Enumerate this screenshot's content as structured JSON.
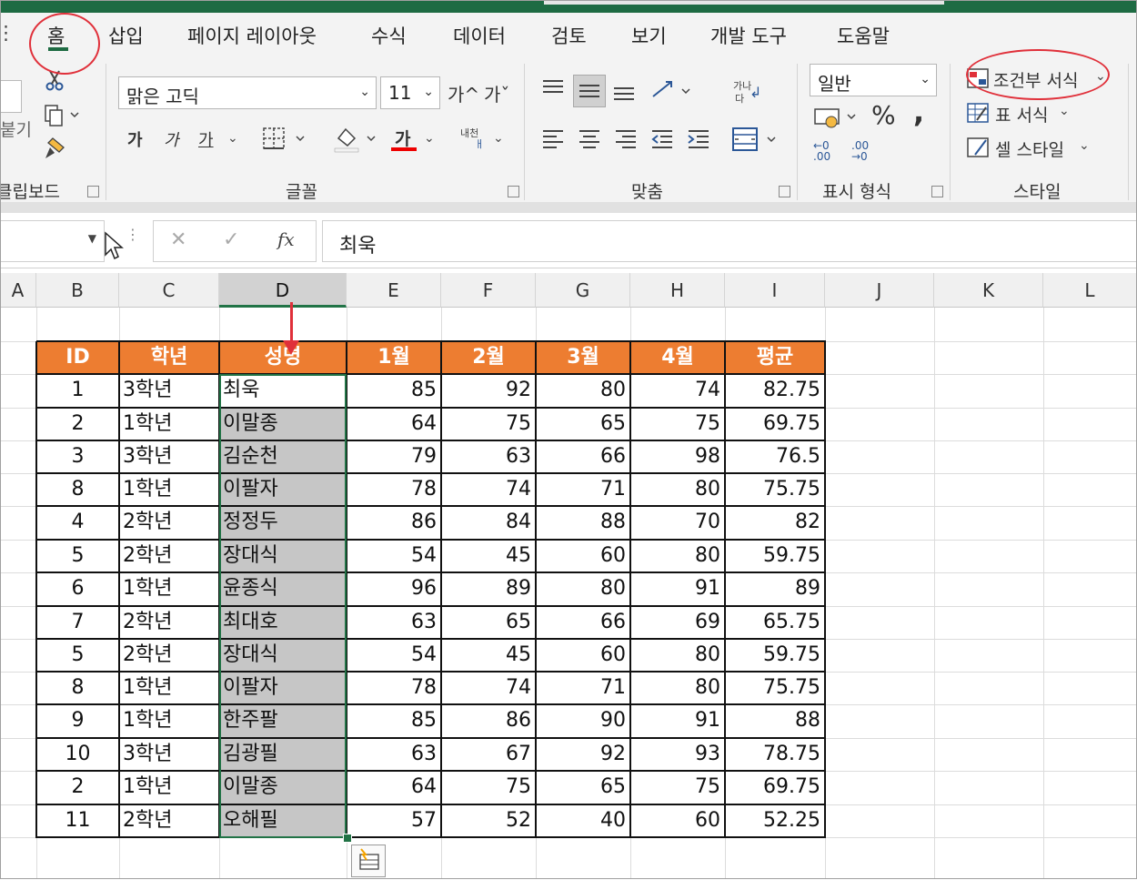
{
  "ribbon_tabs": [
    "홈",
    "삽입",
    "페이지 레이아웃",
    "수식",
    "데이터",
    "검토",
    "보기",
    "개발 도구",
    "도움말"
  ],
  "ribbon": {
    "clipboard_label": "클립보드",
    "clipboard_paste_partial": "붙기",
    "font_group_label": "글꼴",
    "font_name": "맑은 고딕",
    "font_size": "11",
    "increase_font": "가^",
    "decrease_font": "가ˇ",
    "bold": "가",
    "italic": "가",
    "underline": "가",
    "font_color_glyph": "가",
    "phonetic_top": "내천",
    "phonetic_bottom": "ㅐ",
    "align_group_label": "맞춤",
    "wrap_text_top": "가나",
    "wrap_text_bottom": "다",
    "number_group_label": "표시 형식",
    "number_format": "일반",
    "percent": "%",
    "comma": ",",
    "inc_decimal": "←0 .00",
    "dec_decimal": ".00 →0",
    "styles_group_label": "스타일",
    "conditional_formatting": "조건부 서식",
    "format_as_table": "표 서식",
    "cell_styles": "셀 스타일"
  },
  "formula_bar": {
    "name_box": "",
    "cancel_icon": "✕",
    "enter_icon": "✓",
    "fx": "fx",
    "content": "최욱"
  },
  "columns": [
    "A",
    "B",
    "C",
    "D",
    "E",
    "F",
    "G",
    "H",
    "I",
    "J",
    "K",
    "L"
  ],
  "selected_column": "D",
  "table": {
    "headers": [
      "ID",
      "학년",
      "성명",
      "1월",
      "2월",
      "3월",
      "4월",
      "평균"
    ],
    "rows": [
      [
        "1",
        "3학년",
        "최욱",
        "85",
        "92",
        "80",
        "74",
        "82.75"
      ],
      [
        "2",
        "1학년",
        "이말종",
        "64",
        "75",
        "65",
        "75",
        "69.75"
      ],
      [
        "3",
        "3학년",
        "김순천",
        "79",
        "63",
        "66",
        "98",
        "76.5"
      ],
      [
        "8",
        "1학년",
        "이팔자",
        "78",
        "74",
        "71",
        "80",
        "75.75"
      ],
      [
        "4",
        "2학년",
        "정정두",
        "86",
        "84",
        "88",
        "70",
        "82"
      ],
      [
        "5",
        "2학년",
        "장대식",
        "54",
        "45",
        "60",
        "80",
        "59.75"
      ],
      [
        "6",
        "1학년",
        "윤종식",
        "96",
        "89",
        "80",
        "91",
        "89"
      ],
      [
        "7",
        "2학년",
        "최대호",
        "63",
        "65",
        "66",
        "69",
        "65.75"
      ],
      [
        "5",
        "2학년",
        "장대식",
        "54",
        "45",
        "60",
        "80",
        "59.75"
      ],
      [
        "8",
        "1학년",
        "이팔자",
        "78",
        "74",
        "71",
        "80",
        "75.75"
      ],
      [
        "9",
        "1학년",
        "한주팔",
        "85",
        "86",
        "90",
        "91",
        "88"
      ],
      [
        "10",
        "3학년",
        "김광필",
        "63",
        "67",
        "92",
        "93",
        "78.75"
      ],
      [
        "2",
        "1학년",
        "이말종",
        "64",
        "75",
        "65",
        "75",
        "69.75"
      ],
      [
        "11",
        "2학년",
        "오해필",
        "57",
        "52",
        "40",
        "60",
        "52.25"
      ]
    ]
  },
  "colors": {
    "header_fill": "#ed7d31",
    "selection_border": "#217346",
    "annotation_red": "#e0303a",
    "excel_green": "#1e6b43"
  }
}
